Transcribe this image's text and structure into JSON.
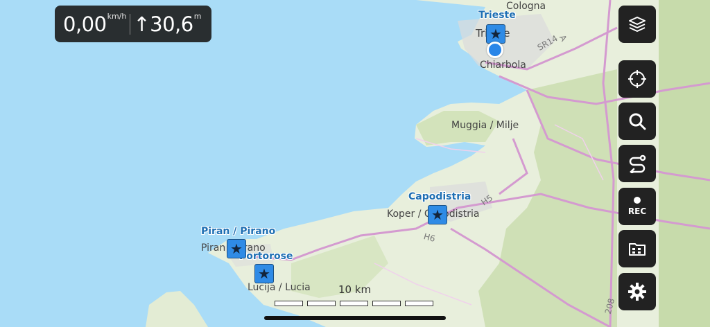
{
  "speed": {
    "value": "0,00",
    "unit": "km/h"
  },
  "altitude": {
    "arrow": "↑",
    "value": "30,6",
    "unit": "m"
  },
  "places": [
    {
      "id": "cologna",
      "label": "Cologna"
    },
    {
      "id": "trieste",
      "label": "Trieste"
    },
    {
      "id": "chiarbola",
      "label": "Chiarbola"
    },
    {
      "id": "muggia",
      "label": "Muggia / Milje"
    },
    {
      "id": "koper",
      "label": "Koper / Capodistria"
    },
    {
      "id": "piran",
      "label": "Piran / Pirano"
    },
    {
      "id": "lucija",
      "label": "Lucija / Lucia"
    }
  ],
  "pois": [
    {
      "id": "trieste-poi",
      "label": "Trieste"
    },
    {
      "id": "capodistria-poi",
      "label": "Capodistria"
    },
    {
      "id": "piran-poi",
      "label": "Piran / Pirano"
    },
    {
      "id": "portorose-poi",
      "label": "Portorose"
    }
  ],
  "road_labels": {
    "sr14": "SR14",
    "h5": "H5",
    "h6": "H6",
    "a": "A",
    "r208": "208"
  },
  "scale": {
    "label": "10 km"
  },
  "controls": {
    "rec_label": "REC"
  },
  "icons": [
    "layers-icon",
    "crosshair-icon",
    "search-icon",
    "route-icon",
    "rec-icon",
    "folder-icon",
    "gear-icon",
    "star-icon"
  ],
  "colors": {
    "water": "#a9dcf7",
    "land": "#e6efd9",
    "forest": "#c9ddb0",
    "road": "#d49ad0",
    "poi": "#2f8be6",
    "control_bg": "#222222"
  }
}
